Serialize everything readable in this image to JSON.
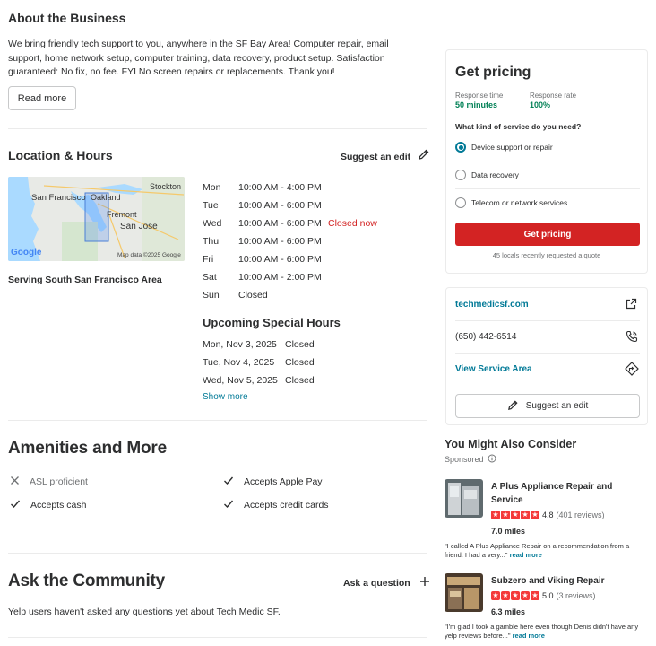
{
  "about": {
    "heading": "About the Business",
    "description": "We bring friendly tech support to you, anywhere in the SF Bay Area! Computer repair, email support, home network setup, computer training, data recovery, product setup. Satisfaction guaranteed: No fix, no fee. FYI No screen repairs or replacements. Thank you!",
    "read_more": "Read more"
  },
  "location": {
    "heading": "Location & Hours",
    "suggest_edit": "Suggest an edit",
    "serving": "Serving South San Francisco Area",
    "map": {
      "labels": [
        "San Francisco",
        "Oakland",
        "Stockton",
        "Fremont",
        "San Jose"
      ],
      "attribution": "Map data ©2025 Google",
      "logo": "Google"
    },
    "hours": [
      {
        "day": "Mon",
        "time": "10:00 AM - 4:00 PM",
        "note": ""
      },
      {
        "day": "Tue",
        "time": "10:00 AM - 6:00 PM",
        "note": ""
      },
      {
        "day": "Wed",
        "time": "10:00 AM - 6:00 PM",
        "note": "Closed now"
      },
      {
        "day": "Thu",
        "time": "10:00 AM - 6:00 PM",
        "note": ""
      },
      {
        "day": "Fri",
        "time": "10:00 AM - 6:00 PM",
        "note": ""
      },
      {
        "day": "Sat",
        "time": "10:00 AM - 2:00 PM",
        "note": ""
      },
      {
        "day": "Sun",
        "time": "Closed",
        "note": ""
      }
    ],
    "special_heading": "Upcoming Special Hours",
    "special": [
      {
        "date": "Mon, Nov 3, 2025",
        "status": "Closed"
      },
      {
        "date": "Tue, Nov 4, 2025",
        "status": "Closed"
      },
      {
        "date": "Wed, Nov 5, 2025",
        "status": "Closed"
      }
    ],
    "show_more": "Show more"
  },
  "amenities": {
    "heading": "Amenities and More",
    "items": [
      {
        "label": "ASL proficient",
        "icon": "x-icon"
      },
      {
        "label": "Accepts Apple Pay",
        "icon": "check-icon"
      },
      {
        "label": "Accepts cash",
        "icon": "check-icon"
      },
      {
        "label": "Accepts credit cards",
        "icon": "check-icon"
      }
    ]
  },
  "community": {
    "heading": "Ask the Community",
    "ask": "Ask a question",
    "empty": "Yelp users haven't asked any questions yet about Tech Medic SF."
  },
  "pricing": {
    "heading": "Get pricing",
    "response_time_label": "Response time",
    "response_time_value": "50 minutes",
    "response_rate_label": "Response rate",
    "response_rate_value": "100%",
    "question": "What kind of service do you need?",
    "options": [
      "Device support or repair",
      "Data recovery",
      "Telecom or network services"
    ],
    "selected": 0,
    "button": "Get pricing",
    "footnote": "45 locals recently requested a quote"
  },
  "contact": {
    "website": "techmedicsf.com",
    "phone": "(650) 442-6514",
    "service_area": "View Service Area",
    "suggest_edit": "Suggest an edit"
  },
  "consider": {
    "heading": "You Might Also Consider",
    "sponsored": "Sponsored",
    "items": [
      {
        "name": "A Plus Appliance Repair and Service",
        "rating": "4.8",
        "reviews": "(401 reviews)",
        "distance": "7.0 miles",
        "quote": "\"I called A Plus Appliance Repair on a recommendation from a friend. I had a very...\"",
        "read_more": "read more"
      },
      {
        "name": "Subzero and Viking Repair",
        "rating": "5.0",
        "reviews": "(3 reviews)",
        "distance": "6.3 miles",
        "quote": "\"I'm glad I took a gamble here even though Denis didn't have any yelp reviews before...\"",
        "read_more": "read more"
      }
    ]
  },
  "colors": {
    "accent_teal": "#027a97",
    "brand_red": "#d32323",
    "response_green": "#008055"
  }
}
